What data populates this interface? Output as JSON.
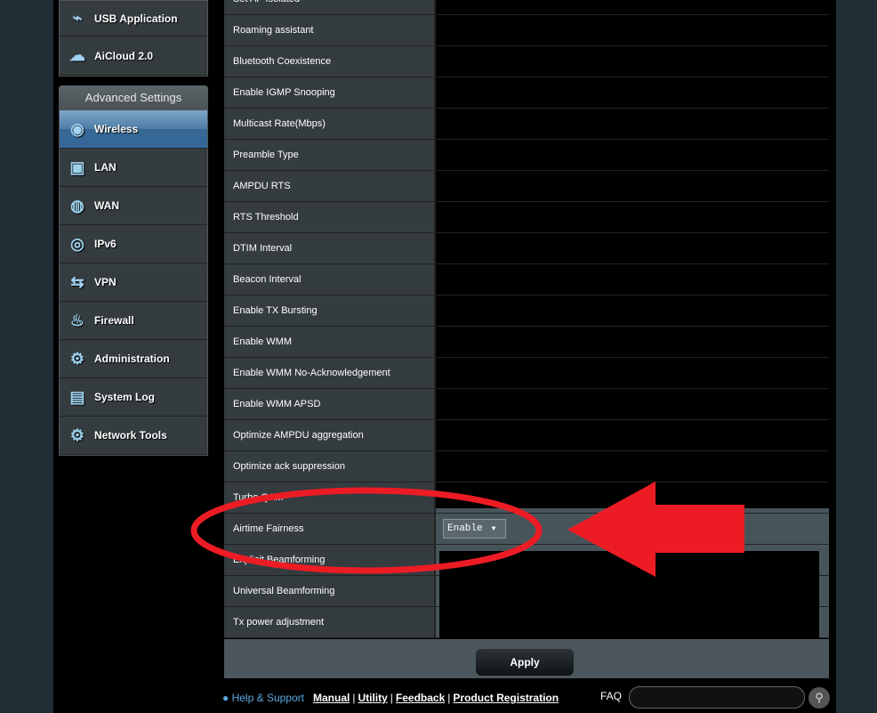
{
  "sidebar": {
    "top_items": [
      {
        "label": "USB Application",
        "icon": "usb-icon"
      },
      {
        "label": "AiCloud 2.0",
        "icon": "cloud-icon"
      }
    ],
    "advanced_header": "Advanced Settings",
    "items": [
      {
        "label": "Wireless",
        "icon": "wireless-icon",
        "selected": true
      },
      {
        "label": "LAN",
        "icon": "lan-icon"
      },
      {
        "label": "WAN",
        "icon": "globe-icon"
      },
      {
        "label": "IPv6",
        "icon": "ipv6-icon"
      },
      {
        "label": "VPN",
        "icon": "vpn-icon"
      },
      {
        "label": "Firewall",
        "icon": "firewall-icon"
      },
      {
        "label": "Administration",
        "icon": "administration-icon"
      },
      {
        "label": "System Log",
        "icon": "system-log-icon"
      },
      {
        "label": "Network Tools",
        "icon": "network-tools-icon"
      }
    ]
  },
  "settings": {
    "rows": [
      "Set AP Isolated",
      "Roaming assistant",
      "Bluetooth Coexistence",
      "Enable IGMP Snooping",
      "Multicast Rate(Mbps)",
      "Preamble Type",
      "AMPDU RTS",
      "RTS Threshold",
      "DTIM Interval",
      "Beacon Interval",
      "Enable TX Bursting",
      "Enable WMM",
      "Enable WMM No-Acknowledgement",
      "Enable WMM APSD",
      "Optimize AMPDU aggregation",
      "Optimize ack suppression",
      "Turbo QAM",
      "Airtime Fairness",
      "Explicit Beamforming",
      "Universal Beamforming",
      "Tx power adjustment"
    ],
    "airtime_fairness_value": "Enable"
  },
  "apply_label": "Apply",
  "footer": {
    "help": "Help & Support",
    "links": [
      "Manual",
      "Utility",
      "Feedback",
      "Product Registration"
    ],
    "faq": "FAQ"
  },
  "annotation_color": "#ed1c24"
}
